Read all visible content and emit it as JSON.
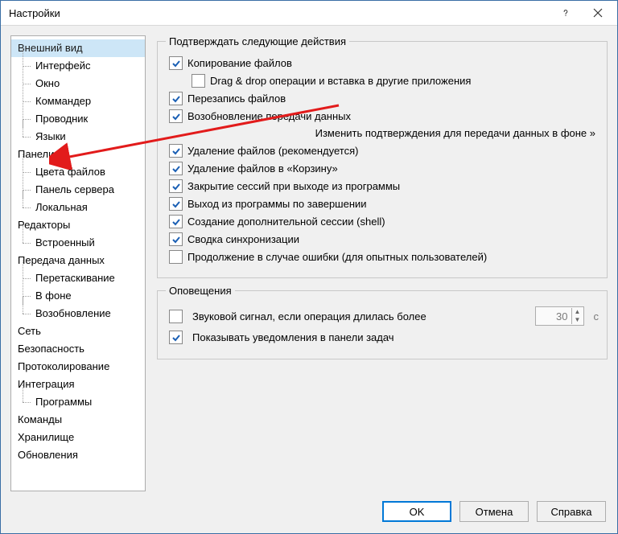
{
  "window": {
    "title": "Настройки"
  },
  "tree": {
    "n0": "Внешний вид",
    "n0_0": "Интерфейс",
    "n0_1": "Окно",
    "n0_2": "Коммандер",
    "n0_3": "Проводник",
    "n0_4": "Языки",
    "n1": "Панели",
    "n1_0": "Цвета файлов",
    "n1_1": "Панель сервера",
    "n1_2": "Локальная",
    "n2": "Редакторы",
    "n2_0": "Встроенный",
    "n3": "Передача данных",
    "n3_0": "Перетаскивание",
    "n3_1": "В фоне",
    "n3_2": "Возобновление",
    "n4": "Сеть",
    "n5": "Безопасность",
    "n6": "Протоколирование",
    "n7": "Интеграция",
    "n7_0": "Программы",
    "n8": "Команды",
    "n9": "Хранилище",
    "n10": "Обновления"
  },
  "group_confirm": {
    "legend": "Подтверждать следующие действия",
    "copy": {
      "label": "Копирование файлов",
      "checked": true
    },
    "dragdrop": {
      "label": "Drag & drop операции и вставка в другие приложения",
      "checked": false
    },
    "overwrite": {
      "label": "Перезапись файлов",
      "checked": true
    },
    "resume": {
      "label": "Возобновление передачи данных",
      "checked": true
    },
    "bg_link": "Изменить подтверждения для передачи данных в фоне »",
    "delete": {
      "label": "Удаление файлов (рекомендуется)",
      "checked": true
    },
    "recycle": {
      "label": "Удаление файлов в «Корзину»",
      "checked": true
    },
    "close_sessions": {
      "label": "Закрытие сессий при выходе из программы",
      "checked": true
    },
    "exit": {
      "label": "Выход из программы по завершении",
      "checked": true
    },
    "shell": {
      "label": "Создание дополнительной сессии (shell)",
      "checked": true
    },
    "syncsum": {
      "label": "Сводка синхронизации",
      "checked": true
    },
    "continue": {
      "label": "Продолжение в случае ошибки (для опытных пользователей)",
      "checked": false
    }
  },
  "group_notify": {
    "legend": "Оповещения",
    "beep": {
      "label": "Звуковой сигнал, если операция длилась более",
      "checked": false
    },
    "seconds": "30",
    "unit": "с",
    "taskbar": {
      "label": "Показывать уведомления в панели задач",
      "checked": true
    }
  },
  "buttons": {
    "ok": "OK",
    "cancel": "Отмена",
    "help": "Справка"
  }
}
